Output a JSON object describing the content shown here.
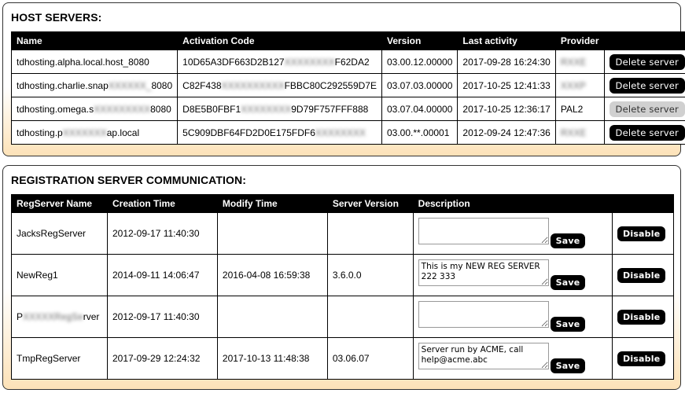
{
  "host_servers": {
    "title": "HOST SERVERS:",
    "columns": [
      "Name",
      "Activation Code",
      "Version",
      "Last activity",
      "Provider",
      ""
    ],
    "rows": [
      {
        "name_prefix": "tdhosting.alpha.local.host_8080",
        "name_blur": "",
        "name_suffix": "",
        "code_prefix": "10D65A3DF663D2B127",
        "code_blur": "XXXXXXXX",
        "code_suffix": "F62DA2",
        "version": "03.00.12.00000",
        "last_activity": "2017-09-28 16:24:30",
        "provider": "",
        "provider_blur": "RXXE",
        "action": "Delete server",
        "action_enabled": true
      },
      {
        "name_prefix": "tdhosting.charlie.snap",
        "name_blur": "XXXXXX_",
        "name_suffix": "8080",
        "code_prefix": "C82F438",
        "code_blur": "XXXXXXXXXX",
        "code_suffix": "FBBC80C292559D7E",
        "version": "03.07.03.00000",
        "last_activity": "2017-10-25 12:41:33",
        "provider": "",
        "provider_blur": "XXXP",
        "action": "Delete server",
        "action_enabled": true
      },
      {
        "name_prefix": "tdhosting.omega.s",
        "name_blur": "XXXXXXXXX",
        "name_suffix": "8080",
        "code_prefix": "D8E5B0FBF1",
        "code_blur": "XXXXXXXX",
        "code_suffix": "9D79F757FFF888",
        "version": "03.07.04.00000",
        "last_activity": "2017-10-25 12:36:17",
        "provider": "PAL2",
        "provider_blur": "",
        "action": "Delete server",
        "action_enabled": false
      },
      {
        "name_prefix": "tdhosting.p",
        "name_blur": "XXXXXXX",
        "name_suffix": "ap.local",
        "code_prefix": "5C909DBF64FD2D0E175FDF6",
        "code_blur": "XXXXXXXX",
        "code_suffix": "",
        "version": "03.00.**.00001",
        "last_activity": "2012-09-24 12:47:36",
        "provider": "",
        "provider_blur": "RXXE",
        "action": "Delete server",
        "action_enabled": true
      }
    ]
  },
  "registration": {
    "title": "REGISTRATION SERVER COMMUNICATION:",
    "columns": [
      "RegServer Name",
      "Creation Time",
      "Modify Time",
      "Server Version",
      "Description",
      ""
    ],
    "save_label": "Save",
    "disable_label": "Disable",
    "rows": [
      {
        "name_prefix": "JacksRegServer",
        "name_blur": "",
        "name_suffix": "",
        "creation_time": "2012-09-17 11:40:30",
        "modify_time": "",
        "server_version": "",
        "description": ""
      },
      {
        "name_prefix": "NewReg1",
        "name_blur": "",
        "name_suffix": "",
        "creation_time": "2014-09-11 14:06:47",
        "modify_time": "2016-04-08 16:59:38",
        "server_version": "3.6.0.0",
        "description": "This is my NEW REG SERVER 222 333"
      },
      {
        "name_prefix": "P",
        "name_blur": "XXXXXRegSe",
        "name_suffix": "rver",
        "creation_time": "2012-09-17 11:40:30",
        "modify_time": "",
        "server_version": "",
        "description": ""
      },
      {
        "name_prefix": "TmpRegServer",
        "name_blur": "",
        "name_suffix": "",
        "creation_time": "2017-09-29 12:24:32",
        "modify_time": "2017-10-13 11:48:38",
        "server_version": "03.06.07",
        "description": "Server run by ACME, call help@acme.abc"
      }
    ]
  },
  "colors": {
    "panel_gradient_end": "#fde2b8",
    "header_bg": "#000000",
    "button_bg": "#000000",
    "button_disabled_bg": "#d0d0d0"
  }
}
